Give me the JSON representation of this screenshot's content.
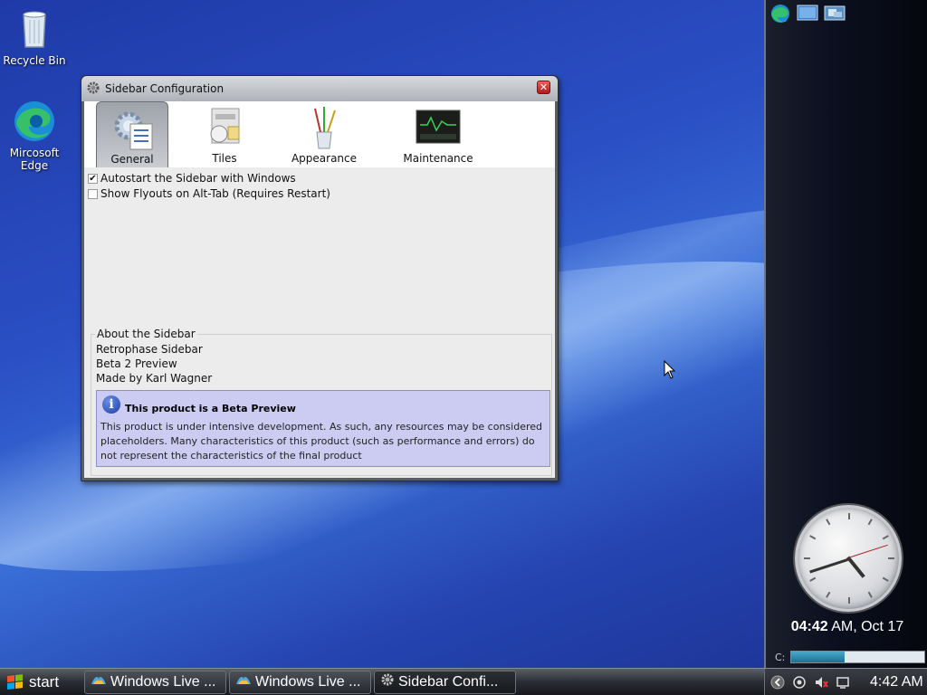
{
  "desktop": {
    "icons": [
      {
        "label": "Recycle Bin"
      },
      {
        "label": "Mircosoft Edge"
      }
    ]
  },
  "dialog": {
    "title": "Sidebar Configuration",
    "close_glyph": "✕",
    "tabs": [
      {
        "label": "General",
        "icon": "gear-icon",
        "active": true
      },
      {
        "label": "Tiles",
        "icon": "tiles-icon",
        "active": false
      },
      {
        "label": "Appearance",
        "icon": "brushes-icon",
        "active": false
      },
      {
        "label": "Maintenance",
        "icon": "monitor-icon",
        "active": false
      }
    ],
    "options": [
      {
        "label": "Autostart the Sidebar with Windows",
        "checked": true
      },
      {
        "label": "Show Flyouts on Alt-Tab (Requires Restart)",
        "checked": false
      }
    ],
    "about": {
      "legend": "About the Sidebar",
      "lines": [
        "Retrophase Sidebar",
        "Beta 2 Preview",
        "Made by Karl Wagner"
      ],
      "notice_title": "This product is a Beta Preview",
      "notice_body": "This product is under intensive development. As such, any resources may be considered placeholders. Many characteristics of this product (such as performance and errors) do not represent the characteristics of the final product",
      "info_glyph": "i"
    }
  },
  "sidebar": {
    "clock_time": "04:42",
    "clock_suffix": " AM, Oct 17",
    "drive_label": "C:",
    "drive_fill": 0.4
  },
  "taskbar": {
    "start_label": "start",
    "buttons": [
      {
        "label": "Windows Live ...",
        "icon": "windows-live-icon"
      },
      {
        "label": "Windows Live ...",
        "icon": "windows-live-icon"
      },
      {
        "label": "Sidebar Confi...",
        "icon": "gear-icon"
      }
    ],
    "tray_time": "4:42 AM"
  },
  "colors": {
    "notice_bg": "#ccccf3",
    "accent": "#1b3fa6"
  }
}
